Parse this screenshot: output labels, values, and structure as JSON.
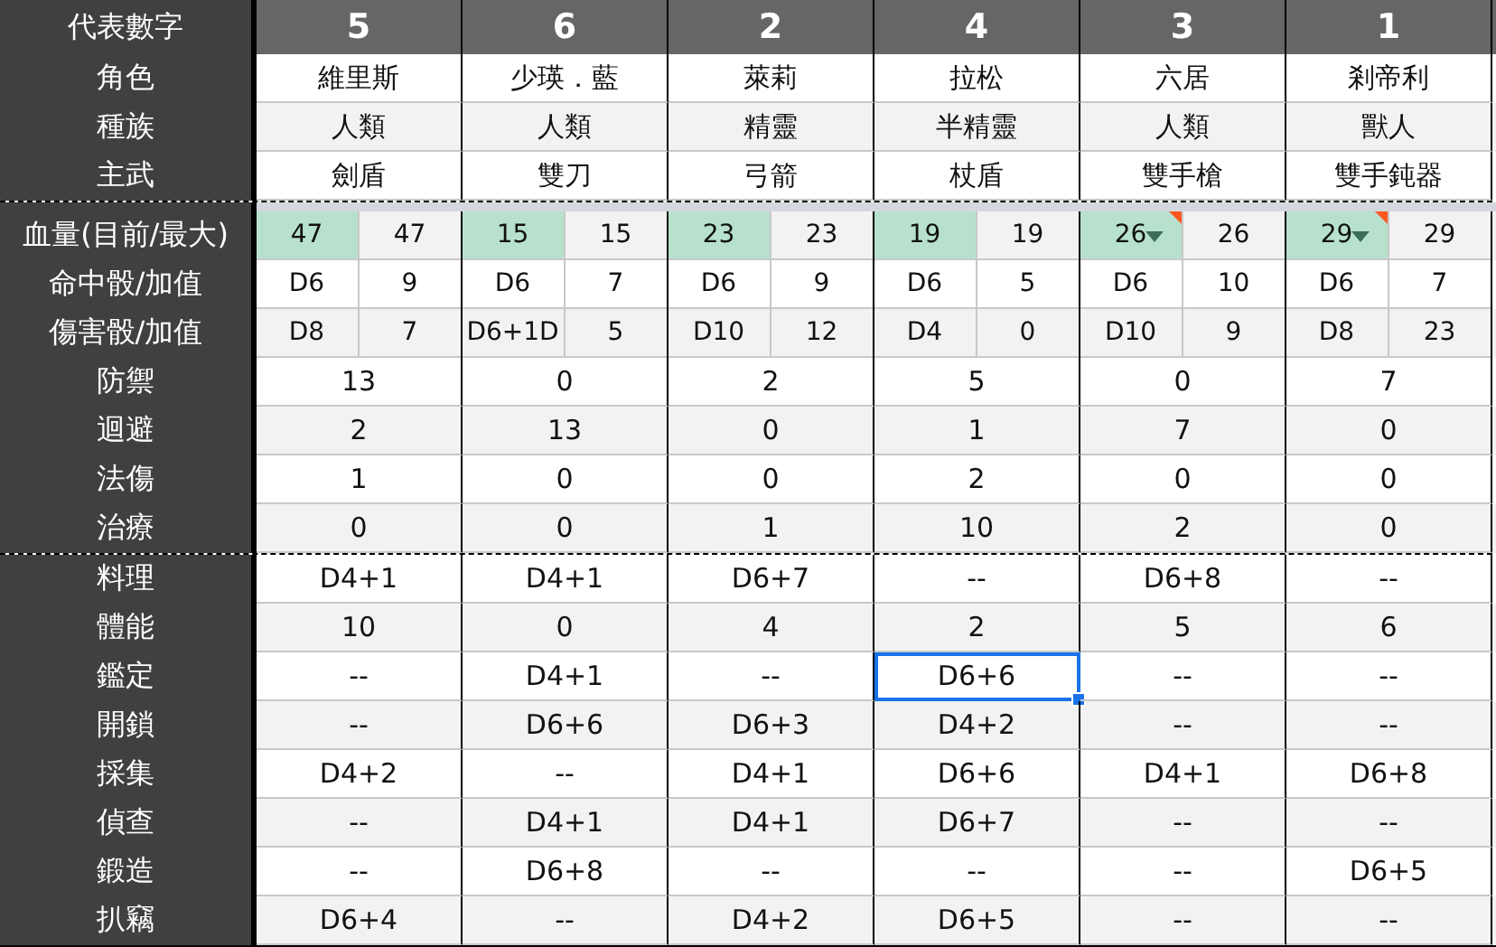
{
  "header": {
    "label": "代表數字",
    "numbers": [
      "5",
      "6",
      "2",
      "4",
      "3",
      "1"
    ]
  },
  "profile_rows": [
    {
      "label": "角色",
      "values": [
        "維里斯",
        "少瑛．藍",
        "萊莉",
        "拉松",
        "六居",
        "剎帝利"
      ]
    },
    {
      "label": "種族",
      "values": [
        "人類",
        "人類",
        "精靈",
        "半精靈",
        "人類",
        "獸人"
      ]
    },
    {
      "label": "主武",
      "values": [
        "劍盾",
        "雙刀",
        "弓箭",
        "杖盾",
        "雙手槍",
        "雙手鈍器"
      ]
    }
  ],
  "pair_rows": [
    {
      "label": "血量(目前/最大)",
      "kind": "hp",
      "cells": [
        {
          "first": "47",
          "second": "47",
          "dropdown": false,
          "note": false
        },
        {
          "first": "15",
          "second": "15",
          "dropdown": false,
          "note": false
        },
        {
          "first": "23",
          "second": "23",
          "dropdown": false,
          "note": false
        },
        {
          "first": "19",
          "second": "19",
          "dropdown": false,
          "note": false
        },
        {
          "first": "26",
          "second": "26",
          "dropdown": true,
          "note": true
        },
        {
          "first": "29",
          "second": "29",
          "dropdown": true,
          "note": true
        }
      ]
    },
    {
      "label": "命中骰/加值",
      "kind": "dice",
      "cells": [
        {
          "first": "D6",
          "second": "9",
          "dropdown": false,
          "note": false
        },
        {
          "first": "D6",
          "second": "7",
          "dropdown": false,
          "note": false
        },
        {
          "first": "D6",
          "second": "9",
          "dropdown": false,
          "note": false
        },
        {
          "first": "D6",
          "second": "5",
          "dropdown": false,
          "note": false
        },
        {
          "first": "D6",
          "second": "10",
          "dropdown": false,
          "note": false
        },
        {
          "first": "D6",
          "second": "7",
          "dropdown": false,
          "note": false
        }
      ]
    },
    {
      "label": "傷害骰/加值",
      "kind": "dice",
      "cells": [
        {
          "first": "D8",
          "second": "7",
          "dropdown": false,
          "note": false
        },
        {
          "first": "D6+1D",
          "second": "5",
          "dropdown": false,
          "note": false
        },
        {
          "first": "D10",
          "second": "12",
          "dropdown": false,
          "note": false
        },
        {
          "first": "D4",
          "second": "0",
          "dropdown": false,
          "note": false
        },
        {
          "first": "D10",
          "second": "9",
          "dropdown": false,
          "note": false
        },
        {
          "first": "D8",
          "second": "23",
          "dropdown": false,
          "note": false
        }
      ]
    }
  ],
  "combat_rows": [
    {
      "label": "防禦",
      "values": [
        "13",
        "0",
        "2",
        "5",
        "0",
        "7"
      ]
    },
    {
      "label": "迴避",
      "values": [
        "2",
        "13",
        "0",
        "1",
        "7",
        "0"
      ]
    },
    {
      "label": "法傷",
      "values": [
        "1",
        "0",
        "0",
        "2",
        "0",
        "0"
      ]
    },
    {
      "label": "治療",
      "values": [
        "0",
        "0",
        "1",
        "10",
        "2",
        "0"
      ]
    }
  ],
  "skill_rows": [
    {
      "label": "料理",
      "values": [
        {
          "text": "D4+1",
          "selected": false
        },
        {
          "text": "D4+1",
          "selected": false
        },
        {
          "text": "D6+7",
          "selected": false
        },
        {
          "text": "--",
          "selected": false
        },
        {
          "text": "D6+8",
          "selected": false
        },
        {
          "text": "--",
          "selected": false
        }
      ]
    },
    {
      "label": "體能",
      "values": [
        {
          "text": "10",
          "selected": false
        },
        {
          "text": "0",
          "selected": false
        },
        {
          "text": "4",
          "selected": false
        },
        {
          "text": "2",
          "selected": false
        },
        {
          "text": "5",
          "selected": false
        },
        {
          "text": "6",
          "selected": false
        }
      ]
    },
    {
      "label": "鑑定",
      "values": [
        {
          "text": "--",
          "selected": false
        },
        {
          "text": "D4+1",
          "selected": false
        },
        {
          "text": "--",
          "selected": false
        },
        {
          "text": "D6+6",
          "selected": true
        },
        {
          "text": "--",
          "selected": false
        },
        {
          "text": "--",
          "selected": false
        }
      ]
    },
    {
      "label": "開鎖",
      "values": [
        {
          "text": "--",
          "selected": false
        },
        {
          "text": "D6+6",
          "selected": false
        },
        {
          "text": "D6+3",
          "selected": false
        },
        {
          "text": "D4+2",
          "selected": false
        },
        {
          "text": "--",
          "selected": false
        },
        {
          "text": "--",
          "selected": false
        }
      ]
    },
    {
      "label": "採集",
      "values": [
        {
          "text": "D4+2",
          "selected": false
        },
        {
          "text": "--",
          "selected": false
        },
        {
          "text": "D4+1",
          "selected": false
        },
        {
          "text": "D6+6",
          "selected": false
        },
        {
          "text": "D4+1",
          "selected": false
        },
        {
          "text": "D6+8",
          "selected": false
        }
      ]
    },
    {
      "label": "偵查",
      "values": [
        {
          "text": "--",
          "selected": false
        },
        {
          "text": "D4+1",
          "selected": false
        },
        {
          "text": "D4+1",
          "selected": false
        },
        {
          "text": "D6+7",
          "selected": false
        },
        {
          "text": "--",
          "selected": false
        },
        {
          "text": "--",
          "selected": false
        }
      ]
    },
    {
      "label": "鍛造",
      "values": [
        {
          "text": "--",
          "selected": false
        },
        {
          "text": "D6+8",
          "selected": false
        },
        {
          "text": "--",
          "selected": false
        },
        {
          "text": "--",
          "selected": false
        },
        {
          "text": "--",
          "selected": false
        },
        {
          "text": "D6+5",
          "selected": false
        }
      ]
    },
    {
      "label": "扒竊",
      "values": [
        {
          "text": "D6+4",
          "selected": false
        },
        {
          "text": "--",
          "selected": false
        },
        {
          "text": "D4+2",
          "selected": false
        },
        {
          "text": "D6+5",
          "selected": false
        },
        {
          "text": "--",
          "selected": false
        },
        {
          "text": "--",
          "selected": false
        }
      ]
    }
  ]
}
